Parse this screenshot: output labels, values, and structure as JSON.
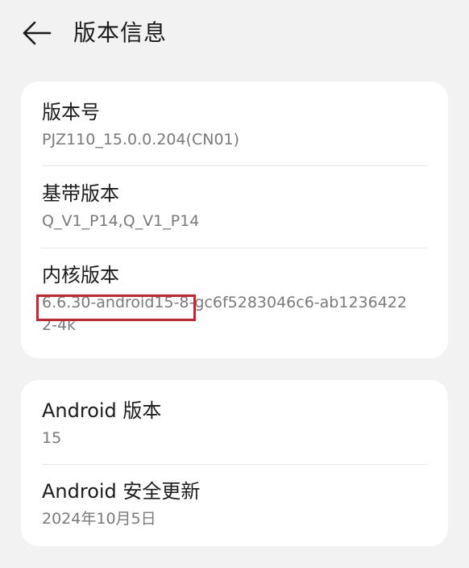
{
  "header": {
    "title": "版本信息"
  },
  "card1": {
    "items": [
      {
        "label": "版本号",
        "value": "PJZ110_15.0.0.204(CN01)"
      },
      {
        "label": "基带版本",
        "value": "Q_V1_P14,Q_V1_P14"
      },
      {
        "label": "内核版本",
        "value": "6.6.30-android15-8-gc6f5283046c6-ab12364222-4k"
      }
    ]
  },
  "card2": {
    "items": [
      {
        "label": "Android 版本",
        "value": "15"
      },
      {
        "label": "Android 安全更新",
        "value": "2024年10月5日"
      }
    ]
  },
  "annotation": {
    "highlight_color": "#d4202a"
  }
}
